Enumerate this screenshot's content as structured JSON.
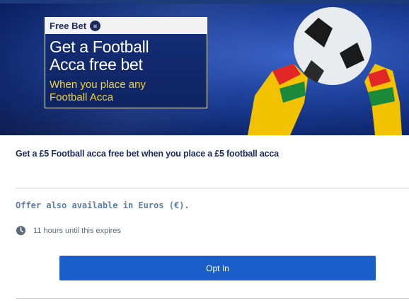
{
  "banner": {
    "tag_label": "Free Bet",
    "headline_line1": "Get a Football",
    "headline_line2": "Acca free bet",
    "sub_line1": "When you place any",
    "sub_line2": "Football Acca",
    "icon": "free-bet-token-icon"
  },
  "offer": {
    "title": "Get a £5 Football acca free bet when you place a £5 football acca",
    "euro_note": "Offer also available in Euros (€).",
    "expiry_text": "11 hours until this expires",
    "expiry_icon": "clock-icon",
    "opt_in_label": "Opt In"
  },
  "colors": {
    "brand_navy": "#1c2b5a",
    "button_blue": "#1a5fc9",
    "subline_yellow": "#f3d33a",
    "note_blue": "#5b7fa8"
  }
}
